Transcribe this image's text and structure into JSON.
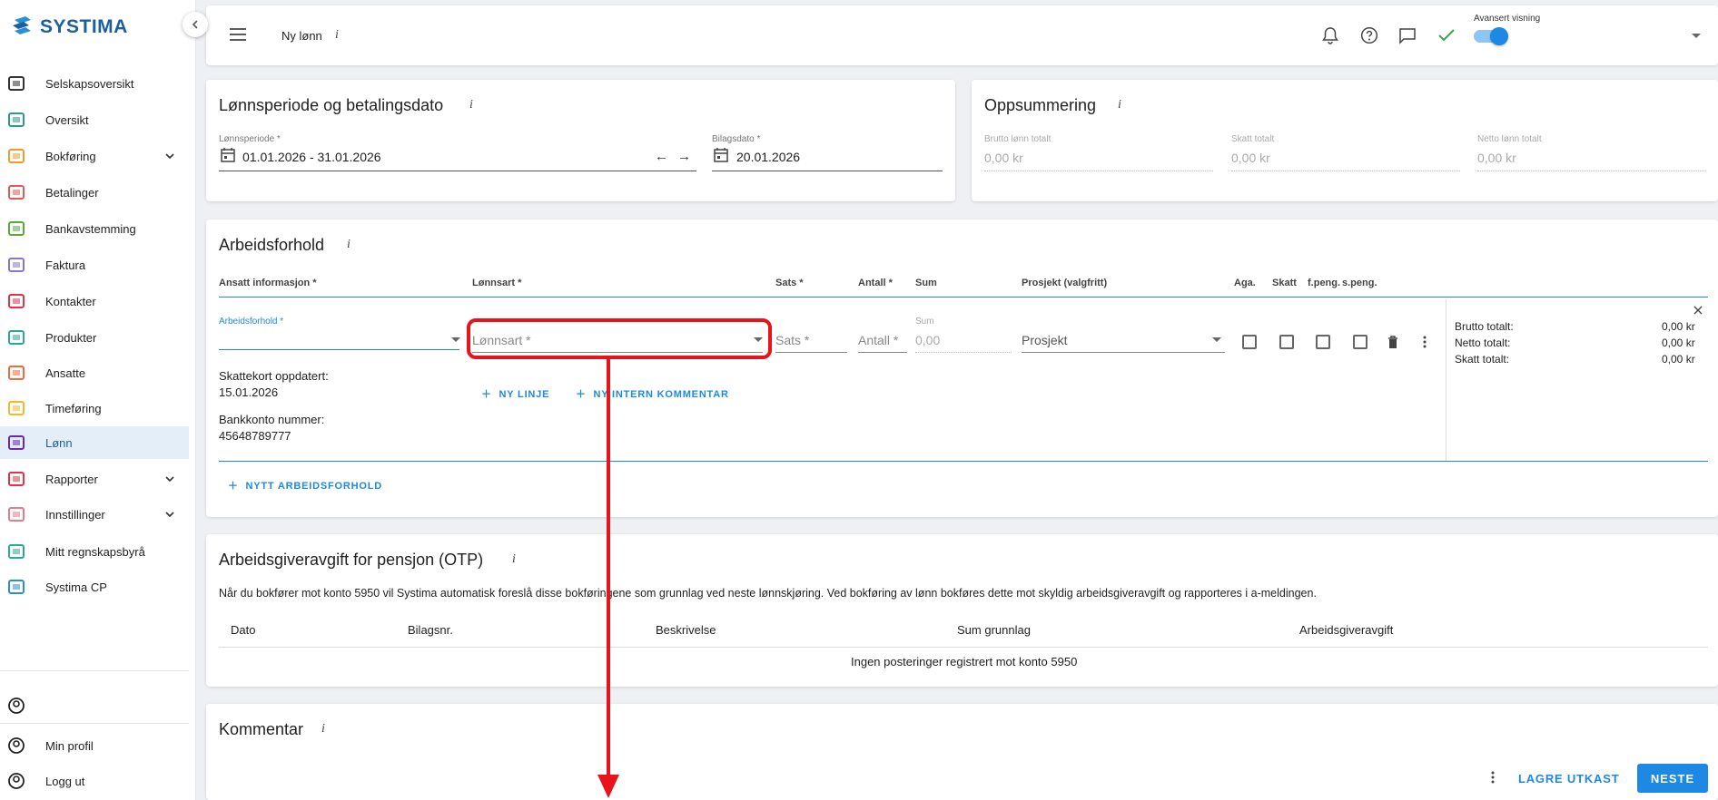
{
  "brand": {
    "name": "SYSTIMA",
    "color": "#1d5f9e"
  },
  "sidebar": {
    "items": [
      {
        "label": "Selskapsoversikt",
        "icon": "building-icon"
      },
      {
        "label": "Oversikt",
        "icon": "home-icon"
      },
      {
        "label": "Bokføring",
        "icon": "ledger-icon",
        "expandable": true
      },
      {
        "label": "Betalinger",
        "icon": "money-icon"
      },
      {
        "label": "Bankavstemming",
        "icon": "bank-sync-icon"
      },
      {
        "label": "Faktura",
        "icon": "invoice-icon"
      },
      {
        "label": "Kontakter",
        "icon": "contacts-icon"
      },
      {
        "label": "Produkter",
        "icon": "box-icon"
      },
      {
        "label": "Ansatte",
        "icon": "badge-icon"
      },
      {
        "label": "Timeføring",
        "icon": "clock-icon"
      },
      {
        "label": "Lønn",
        "icon": "card-icon",
        "active": true
      },
      {
        "label": "Rapporter",
        "icon": "chart-icon",
        "expandable": true
      },
      {
        "label": "Innstillinger",
        "icon": "gear-icon",
        "expandable": true
      },
      {
        "label": "Mitt regnskapsbyrå",
        "icon": "id-card-icon"
      },
      {
        "label": "Systima CP",
        "icon": "systima-logo-icon"
      }
    ],
    "bottom": [
      {
        "label": "",
        "icon": "account-circle-icon"
      },
      {
        "label": "Min profil",
        "icon": "settings-icon"
      },
      {
        "label": "Logg ut",
        "icon": "logout-icon"
      }
    ]
  },
  "topbar": {
    "title": "Ny lønn",
    "info": "i",
    "advanced_label": "Avansert visning",
    "advanced_on": true
  },
  "period": {
    "title": "Lønnsperiode og betalingsdato",
    "info": "i",
    "period_label": "Lønnsperiode *",
    "period_value": "01.01.2026 - 31.01.2026",
    "voucher_label": "Bilagsdato *",
    "voucher_value": "20.01.2026"
  },
  "summary": {
    "title": "Oppsummering",
    "info": "i",
    "fields": [
      {
        "label": "Brutto lønn totalt",
        "value": "0,00 kr"
      },
      {
        "label": "Skatt totalt",
        "value": "0,00 kr"
      },
      {
        "label": "Netto lønn totalt",
        "value": "0,00 kr"
      }
    ]
  },
  "employment": {
    "title": "Arbeidsforhold",
    "info": "i",
    "columns": [
      "Ansatt informasjon *",
      "Lønnsart *",
      "Sats *",
      "Antall *",
      "Sum",
      "Prosjekt (valgfritt)",
      "Aga.",
      "Skatt",
      "f.peng.",
      "s.peng."
    ],
    "row": {
      "employment_label": "Arbeidsforhold *",
      "wage_type_placeholder": "Lønnsart *",
      "rate_placeholder": "Sats *",
      "qty_placeholder": "Antall *",
      "sum_label": "Sum",
      "sum_value": "0,00",
      "project_placeholder": "Prosjekt",
      "taxcard_label": "Skattekort oppdatert:",
      "taxcard_date": "15.01.2026",
      "bank_label": "Bankkonto nummer:",
      "bank_value": "45648789777",
      "new_line": "NY LINJE",
      "new_comment": "NY INTERN KOMMENTAR"
    },
    "totals": [
      {
        "label": "Brutto totalt:",
        "value": "0,00 kr"
      },
      {
        "label": "Netto totalt:",
        "value": "0,00 kr"
      },
      {
        "label": "Skatt totalt:",
        "value": "0,00 kr"
      }
    ],
    "new_employment": "NYTT ARBEIDSFORHOLD"
  },
  "otp": {
    "title": "Arbeidsgiveravgift for pensjon (OTP)",
    "info": "i",
    "description": "Når du bokfører mot konto 5950 vil Systima automatisk foreslå disse bokføringene som grunnlag ved neste lønnskjøring. Ved bokføring av lønn bokføres dette mot skyldig arbeidsgiveravgift og rapporteres i a-meldingen.",
    "columns": [
      "Dato",
      "Bilagsnr.",
      "Beskrivelse",
      "Sum grunnlag",
      "Arbeidsgiveravgift"
    ],
    "empty": "Ingen posteringer registrert mot konto 5950"
  },
  "comment": {
    "title": "Kommentar",
    "info": "i"
  },
  "footer": {
    "save_draft": "LAGRE UTKAST",
    "next": "NESTE"
  },
  "colors": {
    "accent": "#1e88e5",
    "highlight": "#e8141c",
    "active_bg": "#e4eef8"
  }
}
